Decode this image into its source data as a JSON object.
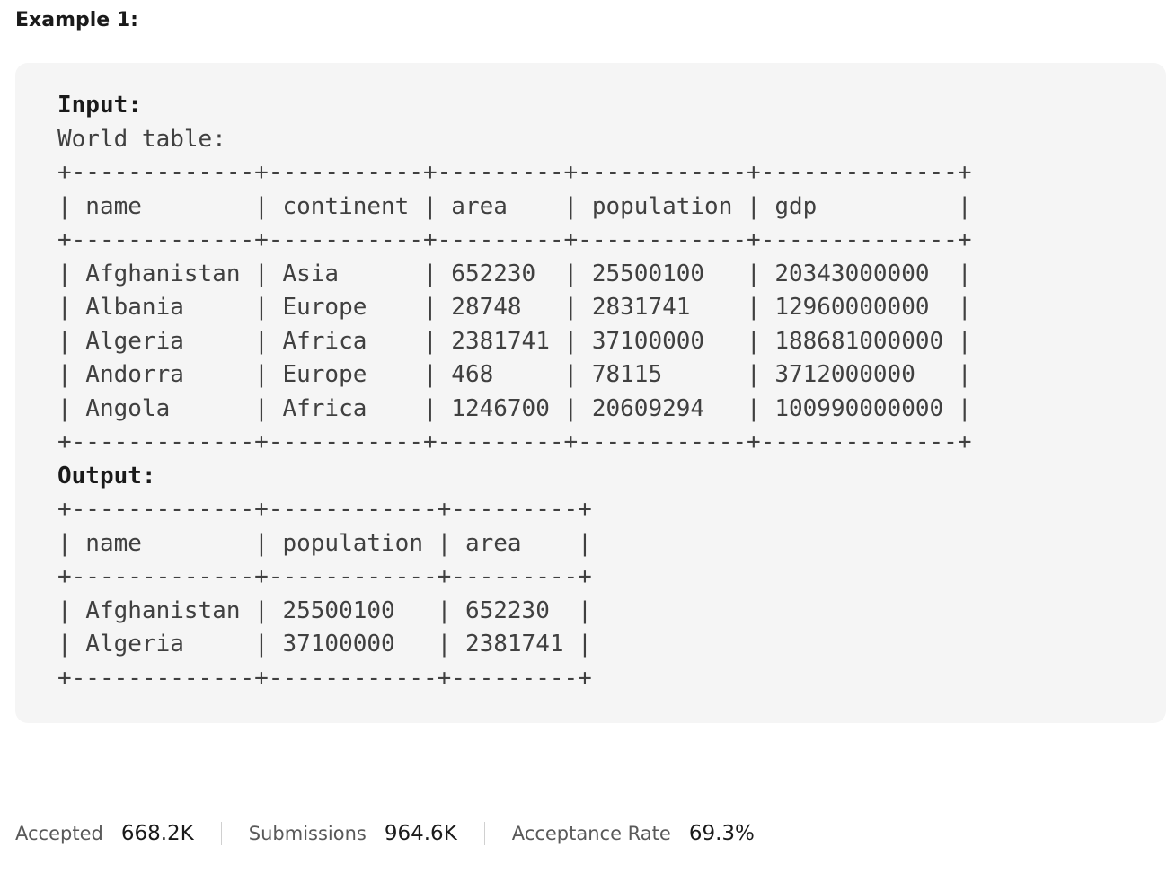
{
  "example": {
    "heading": "Example 1:",
    "input_label": "Input:",
    "table_caption": "World table:",
    "world_table_lines": [
      "+-------------+-----------+---------+------------+--------------+",
      "| name        | continent | area    | population | gdp          |",
      "+-------------+-----------+---------+------------+--------------+",
      "| Afghanistan | Asia      | 652230  | 25500100   | 20343000000  |",
      "| Albania     | Europe    | 28748   | 2831741    | 12960000000  |",
      "| Algeria     | Africa    | 2381741 | 37100000   | 188681000000 |",
      "| Andorra     | Europe    | 468     | 78115      | 3712000000   |",
      "| Angola      | Africa    | 1246700 | 20609294   | 100990000000 |",
      "+-------------+-----------+---------+------------+--------------+"
    ],
    "output_label": "Output:",
    "output_table_lines": [
      "+-------------+------------+---------+",
      "| name        | population | area    |",
      "+-------------+------------+---------+",
      "| Afghanistan | 25500100   | 652230  |",
      "| Algeria     | 37100000   | 2381741 |",
      "+-------------+------------+---------+"
    ]
  },
  "stats": {
    "accepted_label": "Accepted",
    "accepted_value": "668.2K",
    "submissions_label": "Submissions",
    "submissions_value": "964.6K",
    "acceptance_rate_label": "Acceptance Rate",
    "acceptance_rate_value": "69.3%"
  },
  "colors": {
    "code_background": "#f5f5f5",
    "code_text": "#404040",
    "label_text": "#1a1a1a",
    "muted_text": "#595959"
  }
}
